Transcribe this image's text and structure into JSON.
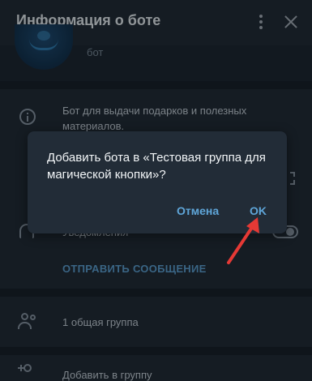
{
  "header": {
    "title": "Информация о боте"
  },
  "profile": {
    "subtitle": "бот"
  },
  "info": {
    "description": "Бот для выдачи подарков и полезных материалов."
  },
  "notifications": {
    "label": "Уведомления",
    "enabled": true
  },
  "actions": {
    "send_message": "ОТПРАВИТЬ СООБЩЕНИЕ"
  },
  "groups": {
    "common_groups": "1 общая группа",
    "add_to_group": "Добавить в группу"
  },
  "dialog": {
    "message": "Добавить бота в «Тестовая группа для магической кнопки»?",
    "cancel_label": "Отмена",
    "ok_label": "OK"
  },
  "colors": {
    "accent": "#5fa6d9",
    "annotation_arrow": "#e53935",
    "background": "#1b232c"
  }
}
